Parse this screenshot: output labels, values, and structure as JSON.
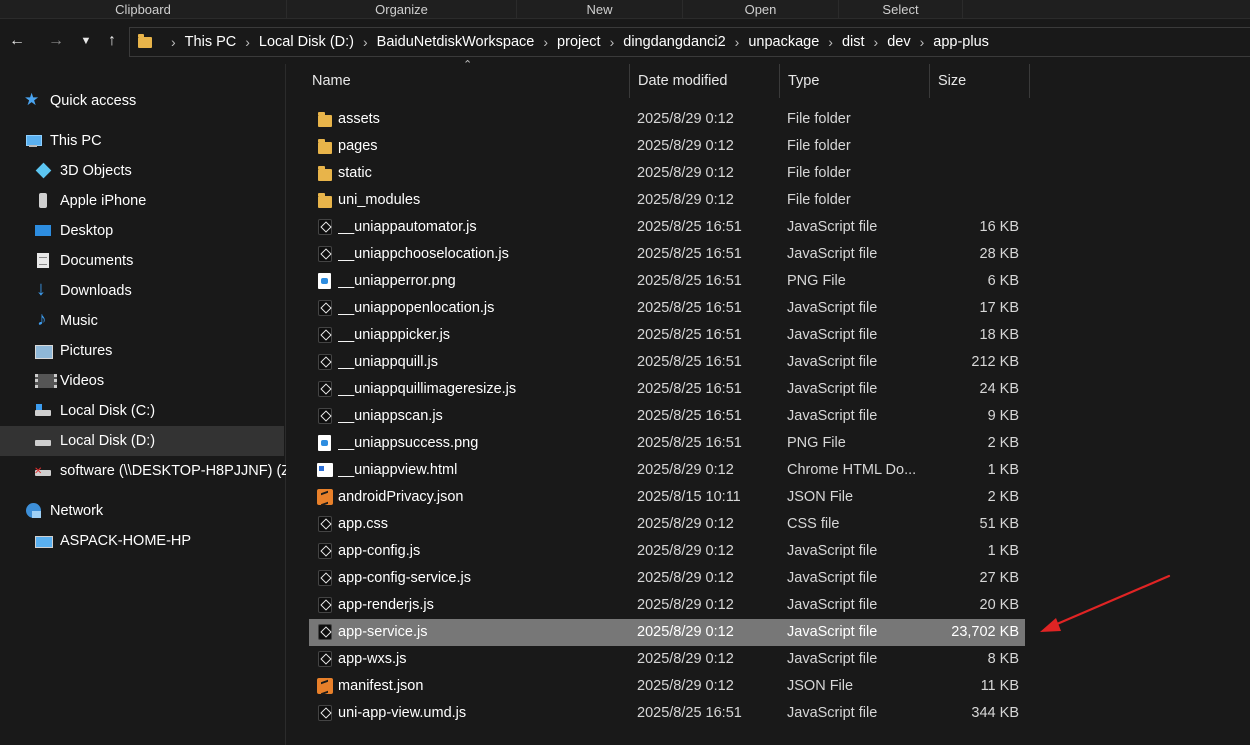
{
  "ribbon": {
    "groups": [
      "Clipboard",
      "Organize",
      "New",
      "Open",
      "Select"
    ]
  },
  "nav": {
    "back_icon": "arrow-left-icon",
    "forward_icon": "arrow-right-icon",
    "recent_icon": "chevron-down-icon",
    "up_icon": "arrow-up-icon"
  },
  "address": {
    "crumbs": [
      "This PC",
      "Local Disk (D:)",
      "BaiduNetdiskWorkspace",
      "project",
      "dingdangdanci2",
      "unpackage",
      "dist",
      "dev",
      "app-plus"
    ]
  },
  "sidebar": {
    "items": [
      {
        "label": "Quick access",
        "icon": "star-icon"
      },
      {
        "label": "This PC",
        "icon": "computer-icon"
      },
      {
        "label": "3D Objects",
        "icon": "3d-objects-icon"
      },
      {
        "label": "Apple iPhone",
        "icon": "phone-icon"
      },
      {
        "label": "Desktop",
        "icon": "desktop-icon"
      },
      {
        "label": "Documents",
        "icon": "documents-icon"
      },
      {
        "label": "Downloads",
        "icon": "downloads-icon"
      },
      {
        "label": "Music",
        "icon": "music-icon"
      },
      {
        "label": "Pictures",
        "icon": "pictures-icon"
      },
      {
        "label": "Videos",
        "icon": "videos-icon"
      },
      {
        "label": "Local Disk (C:)",
        "icon": "drive-icon"
      },
      {
        "label": "Local Disk (D:)",
        "icon": "drive-icon",
        "selected": true
      },
      {
        "label": "software (\\\\DESKTOP-H8PJJNF) (Z:",
        "icon": "network-drive-icon"
      },
      {
        "label": "Network",
        "icon": "network-icon"
      },
      {
        "label": "ASPACK-HOME-HP",
        "icon": "network-computer-icon"
      }
    ]
  },
  "columns": {
    "name": "Name",
    "date": "Date modified",
    "type": "Type",
    "size": "Size"
  },
  "files": [
    {
      "name": "assets",
      "date": "2025/8/29 0:12",
      "type": "File folder",
      "size": "",
      "icon": "folder"
    },
    {
      "name": "pages",
      "date": "2025/8/29 0:12",
      "type": "File folder",
      "size": "",
      "icon": "folder"
    },
    {
      "name": "static",
      "date": "2025/8/29 0:12",
      "type": "File folder",
      "size": "",
      "icon": "folder"
    },
    {
      "name": "uni_modules",
      "date": "2025/8/29 0:12",
      "type": "File folder",
      "size": "",
      "icon": "folder"
    },
    {
      "name": "__uniappautomator.js",
      "date": "2025/8/25 16:51",
      "type": "JavaScript file",
      "size": "16 KB",
      "icon": "js"
    },
    {
      "name": "__uniappchooselocation.js",
      "date": "2025/8/25 16:51",
      "type": "JavaScript file",
      "size": "28 KB",
      "icon": "js"
    },
    {
      "name": "__uniapperror.png",
      "date": "2025/8/25 16:51",
      "type": "PNG File",
      "size": "6 KB",
      "icon": "png"
    },
    {
      "name": "__uniappopenlocation.js",
      "date": "2025/8/25 16:51",
      "type": "JavaScript file",
      "size": "17 KB",
      "icon": "js"
    },
    {
      "name": "__uniapppicker.js",
      "date": "2025/8/25 16:51",
      "type": "JavaScript file",
      "size": "18 KB",
      "icon": "js"
    },
    {
      "name": "__uniappquill.js",
      "date": "2025/8/25 16:51",
      "type": "JavaScript file",
      "size": "212 KB",
      "icon": "js"
    },
    {
      "name": "__uniappquillimageresize.js",
      "date": "2025/8/25 16:51",
      "type": "JavaScript file",
      "size": "24 KB",
      "icon": "js"
    },
    {
      "name": "__uniappscan.js",
      "date": "2025/8/25 16:51",
      "type": "JavaScript file",
      "size": "9 KB",
      "icon": "js"
    },
    {
      "name": "__uniappsuccess.png",
      "date": "2025/8/25 16:51",
      "type": "PNG File",
      "size": "2 KB",
      "icon": "png"
    },
    {
      "name": "__uniappview.html",
      "date": "2025/8/29 0:12",
      "type": "Chrome HTML Do...",
      "size": "1 KB",
      "icon": "html"
    },
    {
      "name": "androidPrivacy.json",
      "date": "2025/8/15 10:11",
      "type": "JSON File",
      "size": "2 KB",
      "icon": "json"
    },
    {
      "name": "app.css",
      "date": "2025/8/29 0:12",
      "type": "CSS file",
      "size": "51 KB",
      "icon": "js"
    },
    {
      "name": "app-config.js",
      "date": "2025/8/29 0:12",
      "type": "JavaScript file",
      "size": "1 KB",
      "icon": "js"
    },
    {
      "name": "app-config-service.js",
      "date": "2025/8/29 0:12",
      "type": "JavaScript file",
      "size": "27 KB",
      "icon": "js"
    },
    {
      "name": "app-renderjs.js",
      "date": "2025/8/29 0:12",
      "type": "JavaScript file",
      "size": "20 KB",
      "icon": "js"
    },
    {
      "name": "app-service.js",
      "date": "2025/8/29 0:12",
      "type": "JavaScript file",
      "size": "23,702 KB",
      "icon": "js",
      "selected": true
    },
    {
      "name": "app-wxs.js",
      "date": "2025/8/29 0:12",
      "type": "JavaScript file",
      "size": "8 KB",
      "icon": "js"
    },
    {
      "name": "manifest.json",
      "date": "2025/8/29 0:12",
      "type": "JSON File",
      "size": "11 KB",
      "icon": "json"
    },
    {
      "name": "uni-app-view.umd.js",
      "date": "2025/8/25 16:51",
      "type": "JavaScript file",
      "size": "344 KB",
      "icon": "js"
    }
  ],
  "colors": {
    "background": "#191919",
    "selected_row": "#777777",
    "selected_sidebar": "#333333",
    "folder": "#e8b44a",
    "annotation_arrow": "#e02424"
  }
}
